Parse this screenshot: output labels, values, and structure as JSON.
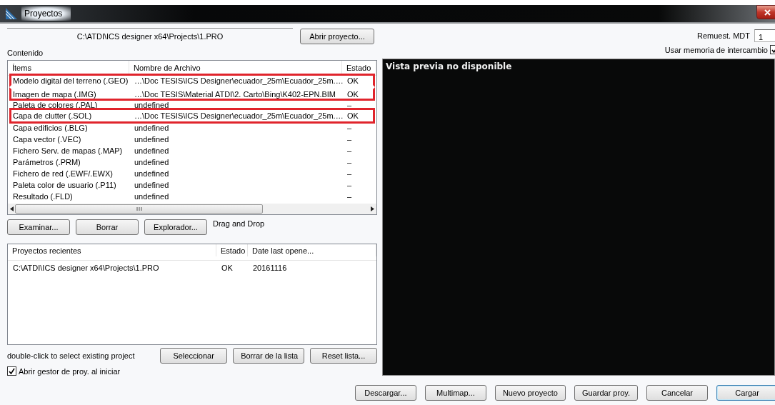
{
  "window": {
    "title": "Proyectos"
  },
  "project_path": "C:\\ATDI\\ICS designer x64\\Projects\\1.PRO",
  "open_button": "Abrir proyecto...",
  "resample": {
    "label": "Remuest. MDT",
    "value": "1"
  },
  "swap_memory": {
    "label": "Usar memoria de intercambio",
    "checked": true
  },
  "content_label": "Contenido",
  "content_table": {
    "columns": [
      "Ítems",
      "Nombre de Archivo",
      "Estado"
    ],
    "rows": [
      {
        "item": "Modelo digital del terreno (.GEO)",
        "file": "…\\Doc TESIS\\ICS Designer\\ecuador_25m\\Ecuador_25m.…",
        "status": "OK",
        "highlighted": true
      },
      {
        "item": "Imagen de mapa (.IMG)",
        "file": "…\\Doc TESIS\\Material ATDI\\2. Carto\\Bing\\K402-EPN.BIM",
        "status": "OK",
        "highlighted": true
      },
      {
        "item": "Paleta de colores (.PAL)",
        "file": "undefined",
        "status": "–",
        "highlighted": false
      },
      {
        "item": "Capa de clutter (.SOL)",
        "file": "…\\Doc TESIS\\ICS Designer\\ecuador_25m\\Ecuador_25m.…",
        "status": "OK",
        "highlighted": true
      },
      {
        "item": "Capa edificios (.BLG)",
        "file": "undefined",
        "status": "–",
        "highlighted": false
      },
      {
        "item": "Capa vector (.VEC)",
        "file": "undefined",
        "status": "–",
        "highlighted": false
      },
      {
        "item": "Fichero Serv. de mapas (.MAP)",
        "file": "undefined",
        "status": "–",
        "highlighted": false
      },
      {
        "item": "Parámetros (.PRM)",
        "file": "undefined",
        "status": "–",
        "highlighted": false
      },
      {
        "item": "Fichero de red (.EWF/.EWX)",
        "file": "undefined",
        "status": "–",
        "highlighted": false
      },
      {
        "item": "Paleta color de usuario (.P11)",
        "file": "undefined",
        "status": "–",
        "highlighted": false
      },
      {
        "item": "Resultado (.FLD)",
        "file": "undefined",
        "status": "–",
        "highlighted": false
      }
    ]
  },
  "content_buttons": [
    "Examinar...",
    "Borrar",
    "Explorador..."
  ],
  "drag_hint": "Drag and Drop",
  "recent_table": {
    "columns": [
      "Proyectos recientes",
      "Estado",
      "Date last opene..."
    ],
    "rows": [
      {
        "path": "C:\\ATDI\\ICS designer x64\\Projects\\1.PRO",
        "status": "OK",
        "date": "20161116"
      }
    ]
  },
  "recent_hint": "double-click to select existing project",
  "recent_buttons": [
    "Seleccionar",
    "Borrar de la lista",
    "Reset lista..."
  ],
  "open_manager": {
    "label": "Abrir gestor de proy. al iniciar",
    "checked": true
  },
  "preview_message": "Vista previa no disponible",
  "footer_buttons": [
    {
      "label": "Descargar...",
      "default": false
    },
    {
      "label": "Multimap...",
      "default": false
    },
    {
      "label": "Nuevo proyecto",
      "default": false
    },
    {
      "label": "Guardar proy.",
      "default": false
    },
    {
      "label": "Cancelar",
      "default": false
    },
    {
      "label": "Cargar",
      "default": true
    }
  ]
}
